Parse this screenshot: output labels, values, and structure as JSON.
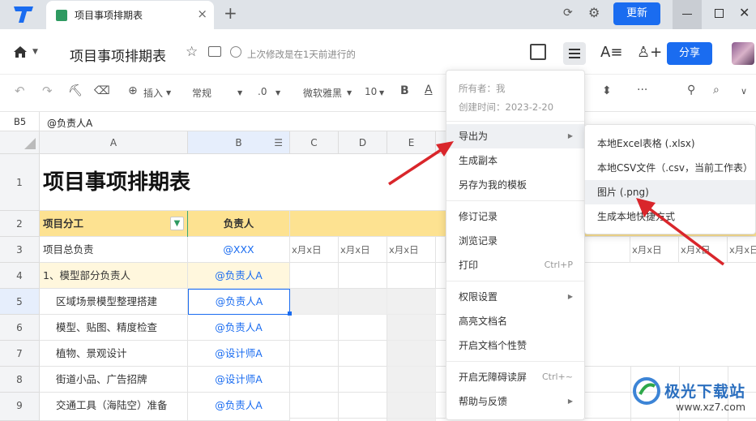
{
  "tabbar": {
    "tab_title": "项目事项排期表",
    "tab_close": "×",
    "new_tab": "+",
    "update_label": "更新",
    "close": "✕"
  },
  "titlebar": {
    "doc_title": "项目事项排期表",
    "last_edit": "上次修改是在1天前进行的",
    "share_label": "分享"
  },
  "toolbar": {
    "undo": "↶",
    "redo": "↷",
    "insert_label": "插入",
    "format_value": "常规",
    "decimal": ".0",
    "font": "微软雅黑",
    "font_size": "10",
    "bold": "B",
    "font_color": "A",
    "more": "···"
  },
  "formula_bar": {
    "cell_ref": "B5",
    "value": "@负责人A"
  },
  "sheet": {
    "columns": [
      "A",
      "B",
      "C",
      "D",
      "E"
    ],
    "right_columns_visible": true,
    "rows": [
      "1",
      "2",
      "3",
      "4",
      "5",
      "6",
      "7",
      "8",
      "9"
    ],
    "title": "项目事项排期表",
    "header_a": "项目分工",
    "header_b": "负责人",
    "date_placeholder": "x月x日",
    "data": [
      {
        "a": "项目总负责",
        "b": "@XXX"
      },
      {
        "a": "1、模型部分负责人",
        "b": "@负责人A"
      },
      {
        "a": "区域场景模型整理搭建",
        "b": "@负责人A"
      },
      {
        "a": "模型、贴图、精度检查",
        "b": "@负责人A"
      },
      {
        "a": "植物、景观设计",
        "b": "@设计师A"
      },
      {
        "a": "街道小品、广告招牌",
        "b": "@设计师A"
      },
      {
        "a": "交通工具（海陆空）准备",
        "b": "@负责人A"
      }
    ]
  },
  "menu": {
    "owner": "所有者：我",
    "created": "创建时间：2023-2-20",
    "items": [
      {
        "label": "导出为",
        "has_sub": true
      },
      {
        "label": "生成副本"
      },
      {
        "label": "另存为我的模板"
      },
      {
        "label": "修订记录"
      },
      {
        "label": "浏览记录"
      },
      {
        "label": "打印",
        "shortcut": "Ctrl+P"
      },
      {
        "label": "权限设置",
        "has_sub": true
      },
      {
        "label": "高亮文档名"
      },
      {
        "label": "开启文档个性赞"
      },
      {
        "label": "开启无障碍读屏",
        "shortcut": "Ctrl+~"
      },
      {
        "label": "帮助与反馈",
        "has_sub": true
      }
    ]
  },
  "submenu": {
    "items": [
      "本地Excel表格 (.xlsx)",
      "本地CSV文件（.csv，当前工作表）",
      "图片 (.png)",
      "生成本地快捷方式"
    ]
  },
  "watermark": {
    "name": "极光下载站",
    "url": "www.xz7.com"
  },
  "colors": {
    "accent": "#1a6cf0",
    "header_yellow": "#fde291",
    "arrow_red": "#d9262b"
  }
}
